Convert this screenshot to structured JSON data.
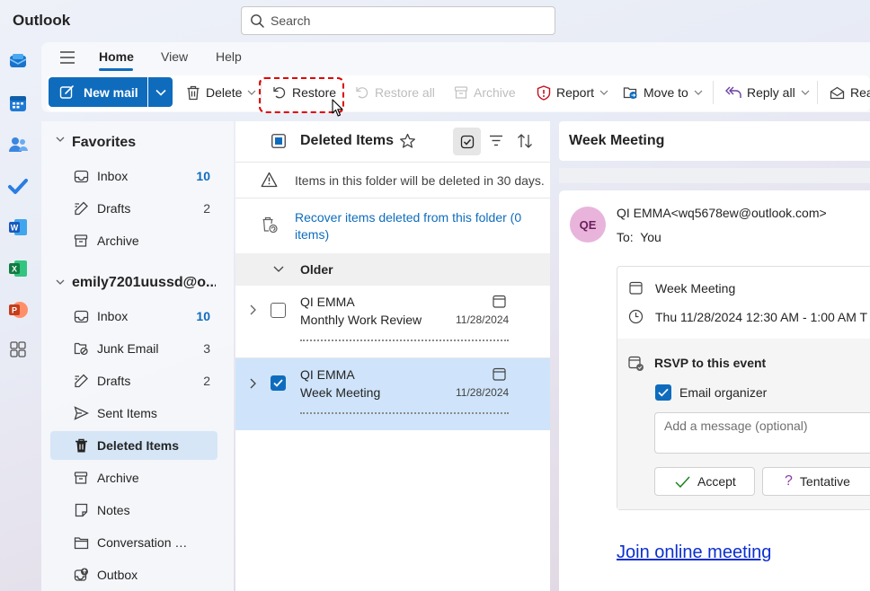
{
  "app": {
    "title": "Outlook"
  },
  "search": {
    "placeholder": "Search"
  },
  "ribbon": {
    "tabs": [
      {
        "label": "Home",
        "active": true
      },
      {
        "label": "View",
        "active": false
      },
      {
        "label": "Help",
        "active": false
      }
    ],
    "toolbar": {
      "new_mail": "New mail",
      "delete": "Delete",
      "restore": "Restore",
      "restore_all": "Restore all",
      "archive": "Archive",
      "report": "Report",
      "move_to": "Move to",
      "reply_all": "Reply all",
      "read": "Rea"
    }
  },
  "folders": {
    "favorites_label": "Favorites",
    "favorites": [
      {
        "label": "Inbox",
        "count": "10",
        "icon": "inbox-icon"
      },
      {
        "label": "Drafts",
        "count": "2",
        "icon": "drafts-icon"
      },
      {
        "label": "Archive",
        "count": "",
        "icon": "archive-icon"
      }
    ],
    "account_label": "emily7201uussd@o...",
    "account": [
      {
        "label": "Inbox",
        "count": "10",
        "icon": "inbox-icon"
      },
      {
        "label": "Junk Email",
        "count": "3",
        "icon": "junk-icon"
      },
      {
        "label": "Drafts",
        "count": "2",
        "icon": "drafts-icon"
      },
      {
        "label": "Sent Items",
        "count": "",
        "icon": "sent-icon"
      },
      {
        "label": "Deleted Items",
        "count": "",
        "icon": "trash-icon",
        "selected": true
      },
      {
        "label": "Archive",
        "count": "",
        "icon": "archive-icon"
      },
      {
        "label": "Notes",
        "count": "",
        "icon": "notes-icon"
      },
      {
        "label": "Conversation Histo...",
        "count": "",
        "icon": "folder-icon"
      },
      {
        "label": "Outbox",
        "count": "",
        "icon": "outbox-icon"
      }
    ]
  },
  "message_list": {
    "title": "Deleted Items",
    "notice": "Items in this folder will be deleted in 30 days.",
    "recover_link": "Recover items deleted from this folder (0 items)",
    "group_label": "Older",
    "messages": [
      {
        "from": "QI EMMA",
        "subject": "Monthly Work Review",
        "date": "11/28/2024",
        "selected": false
      },
      {
        "from": "QI EMMA",
        "subject": "Week Meeting",
        "date": "11/28/2024",
        "selected": true
      }
    ]
  },
  "reading_pane": {
    "title": "Week Meeting",
    "avatar_initials": "QE",
    "sender": "QI EMMA<wq5678ew@outlook.com>",
    "to_label": "To:",
    "to_value": "You",
    "event": {
      "title": "Week Meeting",
      "time": "Thu 11/28/2024 12:30 AM - 1:00 AM T",
      "rsvp_label": "RSVP to this event",
      "email_organizer": "Email organizer",
      "message_placeholder": "Add a message (optional)",
      "accept": "Accept",
      "tentative": "Tentative"
    },
    "join_link": "Join online meeting"
  },
  "colors": {
    "accent": "#0f6cbd",
    "selected_row": "#cfe4fa",
    "highlight_box": "#e00000"
  }
}
